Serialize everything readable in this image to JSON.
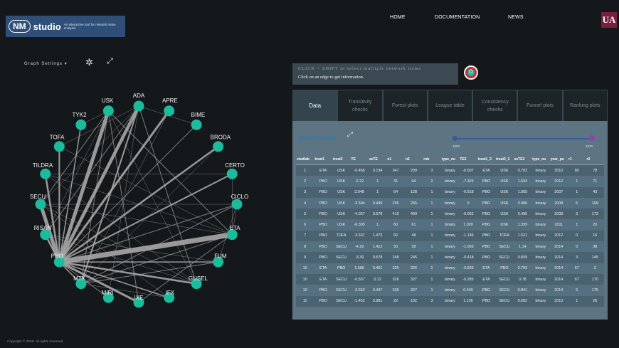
{
  "header": {
    "logo_nm": "NM",
    "logo_studio": "studio",
    "logo_tagline": "An interactive tool for network meta-analysis",
    "nav": [
      "HOME",
      "DOCUMENTATION",
      "NEWS"
    ],
    "uni_logo": "UA"
  },
  "graph": {
    "settings_label": "Graph Settings",
    "node_color": "#1abc9c",
    "edge_color": "#a7a7a7",
    "nodes": [
      {
        "label": "ADA",
        "angle": 0
      },
      {
        "label": "APRE",
        "angle": 22.5
      },
      {
        "label": "BIME",
        "angle": 45
      },
      {
        "label": "BRODA",
        "angle": 67.5
      },
      {
        "label": "CERTO",
        "angle": 90
      },
      {
        "label": "CICLO",
        "angle": 112.5
      },
      {
        "label": "ETA",
        "angle": 135
      },
      {
        "label": "FUM",
        "angle": 157.5
      },
      {
        "label": "GUSEL",
        "angle": 180
      },
      {
        "label": "IFX",
        "angle": 202.5
      },
      {
        "label": "IXE",
        "angle": 225
      },
      {
        "label": "MIRI",
        "angle": 247.5
      },
      {
        "label": "MTX",
        "angle": 270
      },
      {
        "label": "PBO",
        "angle": 292.5
      },
      {
        "label": "RISAN",
        "angle": 315
      },
      {
        "label": "SECU",
        "angle": 337.5
      },
      {
        "label": "TILDRA",
        "angle": 360
      },
      {
        "label": "TOFA",
        "angle": 382.5
      },
      {
        "label": "TYK2",
        "angle": 405
      },
      {
        "label": "USK",
        "angle": 427.5
      }
    ],
    "edges": [
      [
        "PBO",
        "ETA",
        7
      ],
      [
        "PBO",
        "USK",
        5
      ],
      [
        "PBO",
        "ADA",
        4.5
      ],
      [
        "PBO",
        "APRE",
        3
      ],
      [
        "PBO",
        "SECU",
        5
      ],
      [
        "PBO",
        "IXE",
        3
      ],
      [
        "PBO",
        "BRODA",
        2.5
      ],
      [
        "PBO",
        "TILDRA",
        2.5
      ],
      [
        "PBO",
        "CERTO",
        2
      ],
      [
        "PBO",
        "GUSEL",
        2.5
      ],
      [
        "PBO",
        "RISAN",
        2.5
      ],
      [
        "PBO",
        "TOFA",
        2
      ],
      [
        "PBO",
        "TYK2",
        1.5
      ],
      [
        "PBO",
        "CICLO",
        1
      ],
      [
        "PBO",
        "MTX",
        1.5
      ],
      [
        "PBO",
        "IFX",
        1.5
      ],
      [
        "PBO",
        "FUM",
        1.5
      ],
      [
        "PBO",
        "MIRI",
        1
      ],
      [
        "PBO",
        "BIME",
        1
      ],
      [
        "MTX",
        "ADA",
        2
      ],
      [
        "MTX",
        "USK",
        1
      ],
      [
        "MTX",
        "ETA",
        1
      ],
      [
        "MTX",
        "CICLO",
        1
      ],
      [
        "MTX",
        "FUM",
        1
      ],
      [
        "MTX",
        "BRODA",
        0.5
      ],
      [
        "USK",
        "ETA",
        1
      ],
      [
        "USK",
        "SECU",
        1
      ],
      [
        "USK",
        "IXE",
        1
      ],
      [
        "USK",
        "GUSEL",
        0.5
      ],
      [
        "USK",
        "RISAN",
        0.5
      ],
      [
        "ADA",
        "GUSEL",
        1
      ],
      [
        "ADA",
        "RISAN",
        1
      ],
      [
        "ADA",
        "SECU",
        0.5
      ],
      [
        "ADA",
        "MIRI",
        0.5
      ],
      [
        "ETA",
        "IXE",
        1
      ],
      [
        "ETA",
        "TOFA",
        0.5
      ],
      [
        "ETA",
        "SECU",
        0.5
      ],
      [
        "ETA",
        "CICLO",
        0.5
      ],
      [
        "ETA",
        "TILDRA",
        0.5
      ],
      [
        "SECU",
        "GUSEL",
        0.5
      ],
      [
        "SECU",
        "CICLO",
        0.5
      ],
      [
        "SECU",
        "IFX",
        0.5
      ],
      [
        "TILDRA",
        "CERTO",
        0.5
      ],
      [
        "TILDRA",
        "GUSEL",
        0.5
      ],
      [
        "RISAN",
        "GUSEL",
        0.5
      ],
      [
        "RISAN",
        "FUM",
        0.5
      ],
      [
        "APRE",
        "MTX",
        0.5
      ],
      [
        "BIME",
        "ADA",
        0.5
      ],
      [
        "IFX",
        "MTX",
        0.5
      ],
      [
        "CICLO",
        "FUM",
        0.5
      ],
      [
        "CERTO",
        "ETA",
        0.5
      ],
      [
        "TOFA",
        "ADA",
        0.5
      ],
      [
        "TYK2",
        "USK",
        0.5
      ]
    ]
  },
  "info": {
    "line1": "CLICK + SHIFT to select multiple network items",
    "line2": "Click on an edge to get information."
  },
  "tabs": [
    {
      "label": "Data",
      "active": true
    },
    {
      "label": "Transitivity checks",
      "active": false
    },
    {
      "label": "Forest plots",
      "active": false
    },
    {
      "label": "League table",
      "active": false
    },
    {
      "label": "Consistency checks",
      "active": false
    },
    {
      "label": "Funnel plots",
      "active": false
    },
    {
      "label": "Ranking plots",
      "active": false
    }
  ],
  "upload": {
    "label": "Upload your data"
  },
  "slider": {
    "min": "1990",
    "max": "2020",
    "min_year": 1990,
    "max_year": 2020
  },
  "table": {
    "columns": [
      "studlab",
      "treat1",
      "treat2",
      "TE",
      "seTE",
      "n1",
      "n2",
      "rob",
      "type_ou",
      "TE2",
      "treat1_2",
      "treat2_2",
      "seTE2",
      "type_ou",
      "year_pu",
      "r1",
      "r2"
    ],
    "rows": [
      [
        "1",
        "ETA",
        "USK",
        "-0.456",
        "0.134",
        "347",
        "209",
        "3",
        "binary",
        "-0.507",
        "ETA",
        "USK",
        "0.702",
        "binary",
        "2010",
        "80",
        "78"
      ],
      [
        "2",
        "PBO",
        "USK",
        "-2.22",
        "1",
        "31",
        "64",
        "2",
        "binary",
        "-7.325",
        "PBO",
        "USK",
        "1.534",
        "binary",
        "2012",
        "1",
        "71"
      ],
      [
        "3",
        "PBO",
        "USK",
        "3.048",
        "1",
        "64",
        "128",
        "1",
        "binary",
        "-0.918",
        "PBO",
        "USK",
        "1.005",
        "binary",
        "2007",
        "1",
        "43"
      ],
      [
        "4",
        "PBO",
        "USK",
        "-3.594",
        "0.449",
        "255",
        "255",
        "1",
        "binary",
        "0",
        "PBO",
        "USK",
        "0.996",
        "binary",
        "2008",
        "5",
        "109"
      ],
      [
        "5",
        "PBO",
        "USK",
        "-4.057",
        "0.578",
        "410",
        "409",
        "1",
        "binary",
        "-0.002",
        "PBO",
        "USK",
        "0.495",
        "binary",
        "2008",
        "3",
        "173"
      ],
      [
        "6",
        "PBO",
        "USK",
        "-6.305",
        "1",
        "60",
        "61",
        "1",
        "binary",
        "1.020",
        "PBO",
        "USK",
        "1.339",
        "binary",
        "2011",
        "1",
        "20"
      ],
      [
        "7",
        "PBO",
        "TOFA",
        "-3.637",
        "1.473",
        "60",
        "48",
        "1",
        "binary",
        "-1.136",
        "PBO",
        "TOFA",
        "1.521",
        "binary",
        "2012",
        "0",
        "16"
      ],
      [
        "8",
        "PBO",
        "SECU",
        "-4.29",
        "1.412",
        "50",
        "59",
        "1",
        "binary",
        "-1.093",
        "PBO",
        "SECU",
        "1.14",
        "binary",
        "2014",
        "0",
        "38"
      ],
      [
        "9",
        "PBO",
        "SECU",
        "-3.39",
        "0.578",
        "248",
        "245",
        "1",
        "binary",
        "-0.418",
        "PBO",
        "SECU",
        "0.839",
        "binary",
        "2014",
        "3",
        "145"
      ],
      [
        "10",
        "ETA",
        "PBO",
        "2.586",
        "0.451",
        "326",
        "326",
        "1",
        "binary",
        "-0.693",
        "ETA",
        "PBO",
        "0.703",
        "binary",
        "2014",
        "67",
        "3"
      ],
      [
        "10",
        "ETA",
        "SECU",
        "-0.557",
        "0.12",
        "326",
        "327",
        "1",
        "binary",
        "-0.285",
        "ETA",
        "SECU",
        "0.78",
        "binary",
        "2014",
        "67",
        "170"
      ],
      [
        "10",
        "PBO",
        "SECU",
        "-3.552",
        "0.447",
        "326",
        "327",
        "1",
        "binary",
        "0.409",
        "PBO",
        "SECU",
        "0.841",
        "binary",
        "2014",
        "5",
        "175"
      ],
      [
        "11",
        "PBO",
        "SECU",
        "-1.452",
        "3.981",
        "22",
        "102",
        "3",
        "binary",
        "1.136",
        "PBO",
        "SECU",
        "0.682",
        "binary",
        "2013",
        "1",
        "26"
      ]
    ]
  },
  "footer": {
    "copyright": "Copyright © 2020. All rights reserved."
  }
}
